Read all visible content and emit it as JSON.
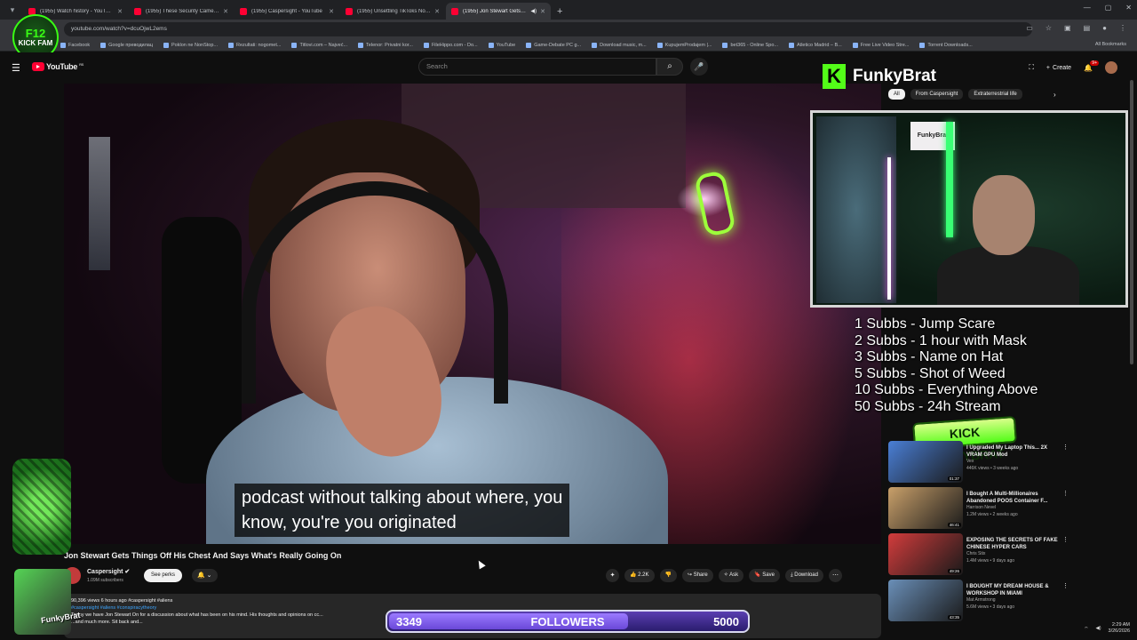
{
  "browser": {
    "tabs": [
      {
        "title": "(1955) Watch history - YouTube",
        "active": false
      },
      {
        "title": "(1955) These Security Camera ...",
        "active": false
      },
      {
        "title": "(1955) Caspersight - YouTube",
        "active": false
      },
      {
        "title": "(1955) Unsettling TikToks No O...",
        "active": false
      },
      {
        "title": "(1955) Jon Stewart Gets Thi...",
        "active": true
      }
    ],
    "url": "youtube.com/watch?v=dcuOjwL2ems",
    "bookmarks": [
      "Facebook",
      "Google преводилац",
      "Poklon ne NonStop...",
      "Rezultati: nogomet...",
      "Titlovi.com – Najveć...",
      "Telenor: Privatni kor...",
      "FileHippo.com - Do...",
      "YouTube",
      "Game-Debate PC g...",
      "Download music, m...",
      "KupujemProdajem |...",
      "bet365 - Online Spo...",
      "Atletico Madrid – B...",
      "Free Live Video Stre...",
      "Torrent Downloads..."
    ],
    "all_bookmarks": "All Bookmarks"
  },
  "logo_badge": {
    "line1": "F12",
    "line2": "KICK FAM"
  },
  "youtube": {
    "logo_text": "YouTube",
    "region": "RS",
    "search_placeholder": "Search",
    "create_label": "Create",
    "notif_count": "9+"
  },
  "video": {
    "subtitle": "podcast without talking about where, you\nknow, you're you originated",
    "title": "Jon Stewart Gets Things Off His Chest And Says What's Really Going On"
  },
  "channel": {
    "name": "Caspersight",
    "subs": "1.09M subscribers",
    "perks_label": "See perks"
  },
  "actions": {
    "likes": "2.2K",
    "share": "Share",
    "ask": "Ask",
    "save": "Save",
    "download": "Download"
  },
  "description": {
    "stats": "90,396 views  6 hours ago  #caspersight #aliens",
    "tags": "#caspersight #aliens #conspiracytheory",
    "text": "Today we have Jon Stewart On for a discussion about what  has been on his mind. His thoughts and opinions on cc...",
    "more": "...and much more. Sit back and..."
  },
  "stream_overlay": {
    "brand_letter": "K",
    "brand_name": "FunkyBrat",
    "webcam_sign": "FunkyBrat",
    "goals": [
      "1 Subbs - Jump Scare",
      "2 Subbs - 1 hour with Mask",
      "3 Subbs - Name on Hat",
      "5 Subbs - Shot of Weed",
      "10 Subbs - Everything Above",
      "50 Subbs - 24h Stream"
    ],
    "kick_logo": "KICK FUNKYBRAT",
    "followers_current": "3349",
    "followers_label": "FOLLOWERS",
    "followers_goal": "5000",
    "followers_progress": 0.67,
    "avatar_label": "FunkyBrat"
  },
  "chips": [
    "All",
    "From Caspersight",
    "Extraterrestrial life"
  ],
  "recommendations": [
    {
      "title": "I Upgraded My Laptop This... 2X VRAM GPU Mod",
      "channel": "Vex",
      "meta": "446K views • 3 weeks ago",
      "duration": "01:37",
      "color": "#4a7fd6"
    },
    {
      "title": "I Bought A Multi-Millionaires Abandoned POOS Container F...",
      "channel": "Harrison Nevel",
      "meta": "1.2M views • 2 weeks ago",
      "duration": "46:41",
      "color": "#c9a06a"
    },
    {
      "title": "EXPOSING THE SECRETS OF FAKE CHINESE HYPER CARS",
      "channel": "Chris Stix",
      "meta": "1.4M views • 9 days ago",
      "duration": "49:26",
      "color": "#d23c3c"
    },
    {
      "title": "I BOUGHT MY DREAM HOUSE & WORKSHOP IN MIAMI",
      "channel": "Mat Armstrong",
      "meta": "5.6M views • 3 days ago",
      "duration": "43:35",
      "color": "#6a8fb8"
    }
  ],
  "tray": {
    "time": "2:29 AM",
    "date": "3/26/2026"
  }
}
